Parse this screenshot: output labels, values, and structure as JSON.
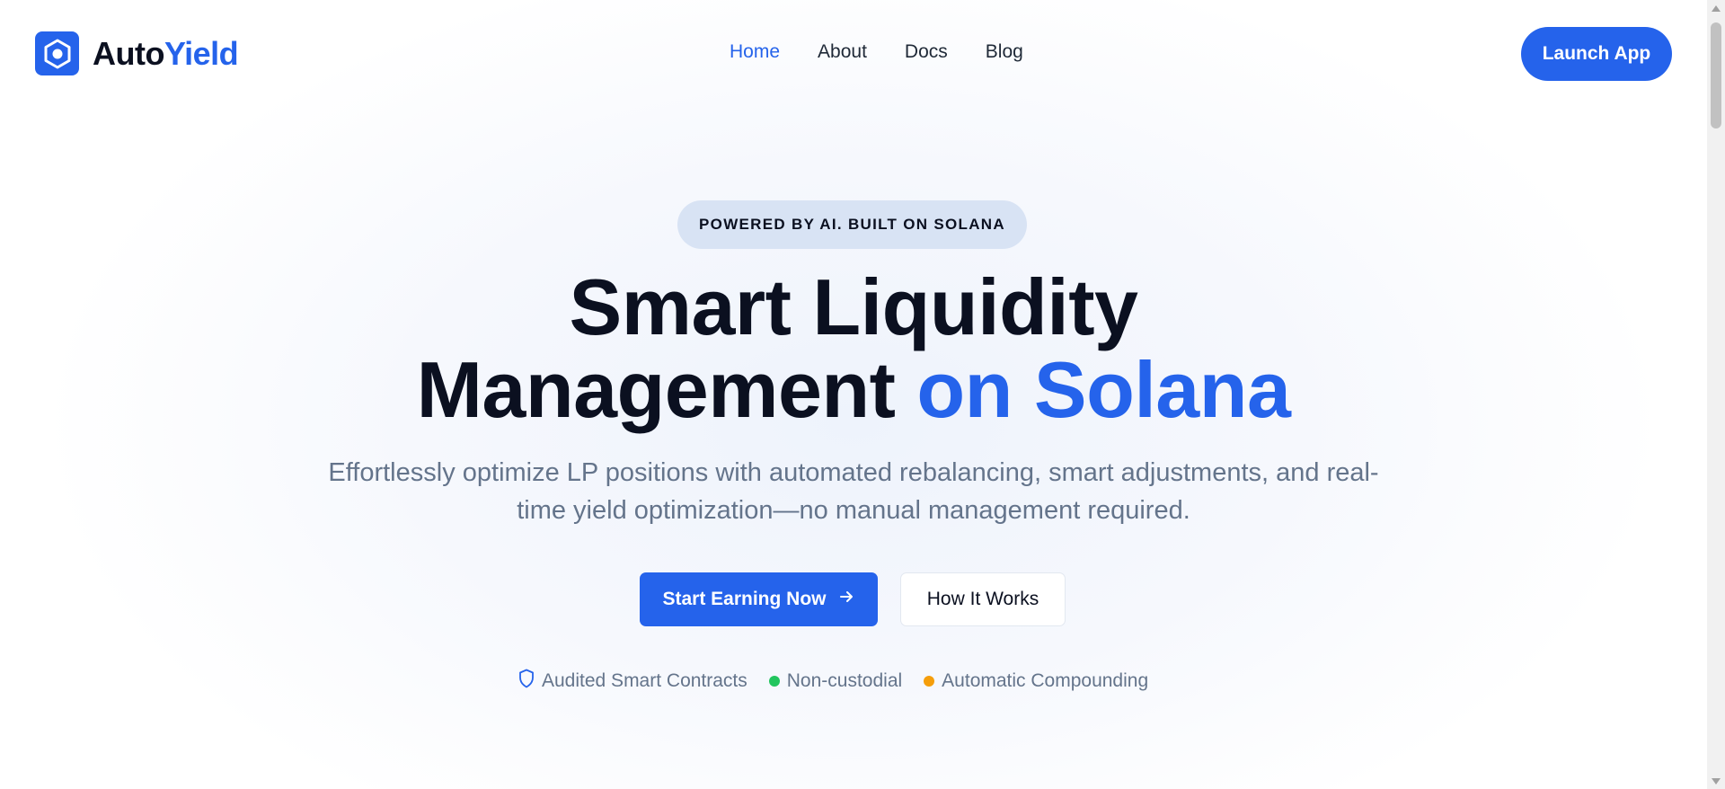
{
  "brand": {
    "name_part1": "Auto",
    "name_part2": "Yield",
    "accent_color": "#2563eb",
    "logo_icon": "hexagon-icon"
  },
  "nav": {
    "items": [
      {
        "label": "Home",
        "active": true
      },
      {
        "label": "About"
      },
      {
        "label": "Docs"
      },
      {
        "label": "Blog"
      }
    ]
  },
  "header": {
    "launch_label": "Launch App"
  },
  "hero": {
    "badge": "POWERED BY AI. BUILT ON SOLANA",
    "headline_line1": "Smart Liquidity",
    "headline_line2_dark": "Management",
    "headline_line2_blue": "on Solana",
    "subheadline": "Effortlessly optimize LP positions with automated rebalancing, smart adjustments, and real-time yield optimization—no manual management required.",
    "primary_cta": "Start Earning Now",
    "primary_cta_icon": "arrow-right-icon",
    "secondary_cta": "How It Works",
    "trust": [
      {
        "label": "Audited Smart Contracts",
        "icon": "shield-icon",
        "color": "#2563eb"
      },
      {
        "label": "Non-custodial",
        "icon": "dot-icon",
        "color": "#22c55e"
      },
      {
        "label": "Automatic Compounding",
        "icon": "dot-icon",
        "color": "#f59e0b"
      }
    ]
  }
}
